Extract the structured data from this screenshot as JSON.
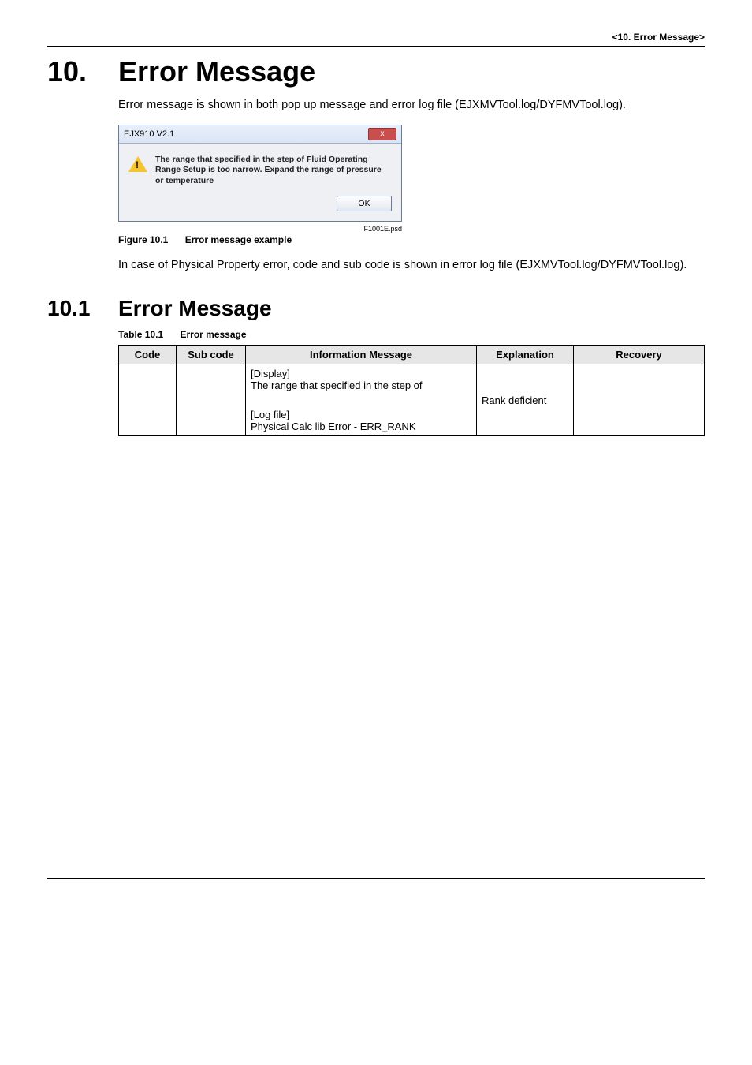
{
  "header": {
    "breadcrumb": "<10.  Error Message>"
  },
  "chapter": {
    "number": "10.",
    "title": "Error Message"
  },
  "intro_para": "Error message is shown in both pop up message and error log file (EJXMVTool.log/DYFMVTool.log).",
  "dialog": {
    "title": "EJX910 V2.1",
    "close_glyph": "x",
    "body_text": "The range that specified in the step of Fluid Operating Range Setup is too narrow. Expand the range of pressure or temperature",
    "ok_label": "OK",
    "filename_label": "F1001E.psd"
  },
  "figure_caption": {
    "label": "Figure 10.1",
    "text": "Error message example"
  },
  "post_fig_para": "In case of Physical Property error, code and sub code is shown in error log file (EJXMVTool.log/DYFMVTool.log).",
  "section": {
    "number": "10.1",
    "title": "Error Message"
  },
  "table_caption": {
    "label": "Table 10.1",
    "text": "Error message"
  },
  "table": {
    "headers": {
      "code": "Code",
      "subcode": "Sub code",
      "info": "Information Message",
      "explanation": "Explanation",
      "recovery": "Recovery"
    },
    "row": {
      "code": "",
      "subcode": "",
      "info_display_label": "[Display]",
      "info_display_text": "The range that specified in the step of",
      "info_log_label": "[Log file]",
      "info_log_text": "Physical Calc lib Error - ERR_RANK",
      "explanation": "Rank deficient",
      "recovery": ""
    }
  }
}
